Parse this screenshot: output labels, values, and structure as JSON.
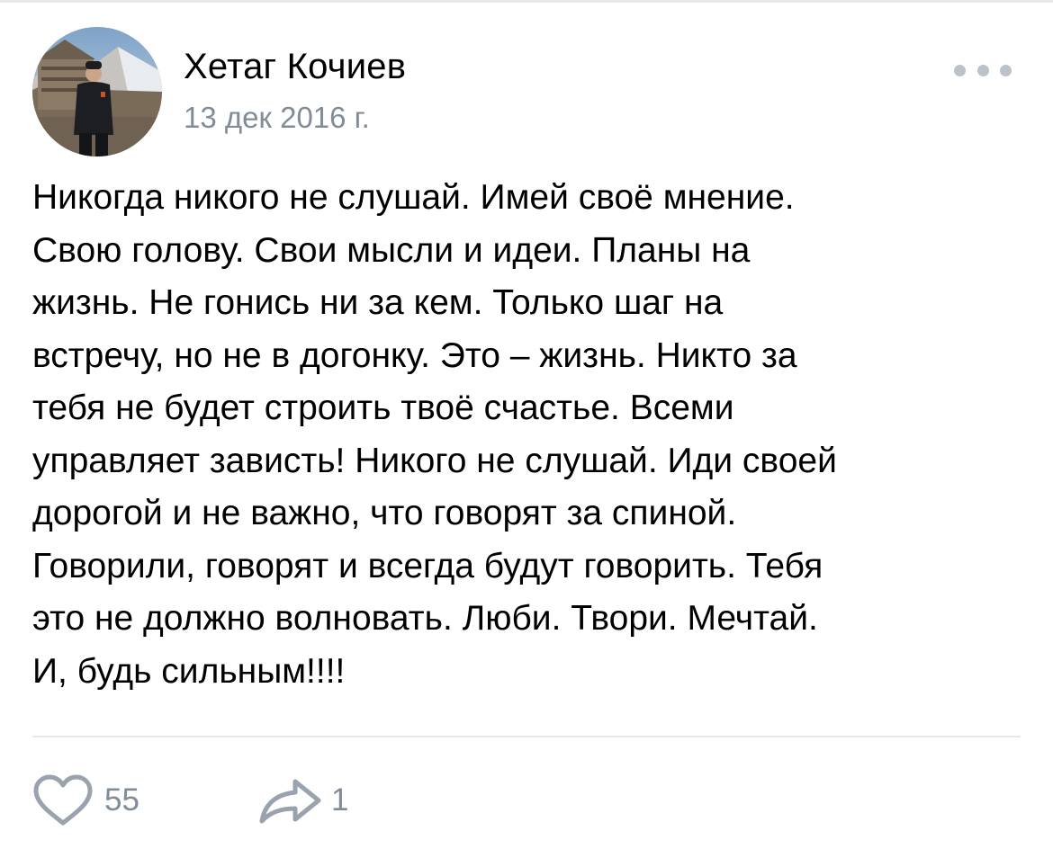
{
  "post": {
    "author": "Хетаг Кочиев",
    "date": "13 дек 2016 г.",
    "text": "Никогда никого не слушай. Имей своё мнение.\nСвою голову. Свои мысли и идеи. Планы на\nжизнь. Не гонись ни за кем. Только шаг на\nвстречу, но не в догонку. Это – жизнь. Никто за\nтебя не будет строить твоё счастье. Всеми\nуправляет зависть! Никого не слушай. Иди своей\nдорогой и не важно, что говорят за спиной.\nГоворили, говорят и всегда будут говорить. Тебя\nэто не должно волновать. Люби. Твори. Мечтай.\nИ, будь сильным!!!!"
  },
  "actions": {
    "likes": "55",
    "shares": "1",
    "like_icon": "heart-icon",
    "share_icon": "share-arrow-icon",
    "more_icon": "more-dots-icon"
  },
  "colors": {
    "text": "#000000",
    "secondary": "#818c99",
    "icon": "#99a2ad",
    "divider": "#e6e8eb"
  }
}
